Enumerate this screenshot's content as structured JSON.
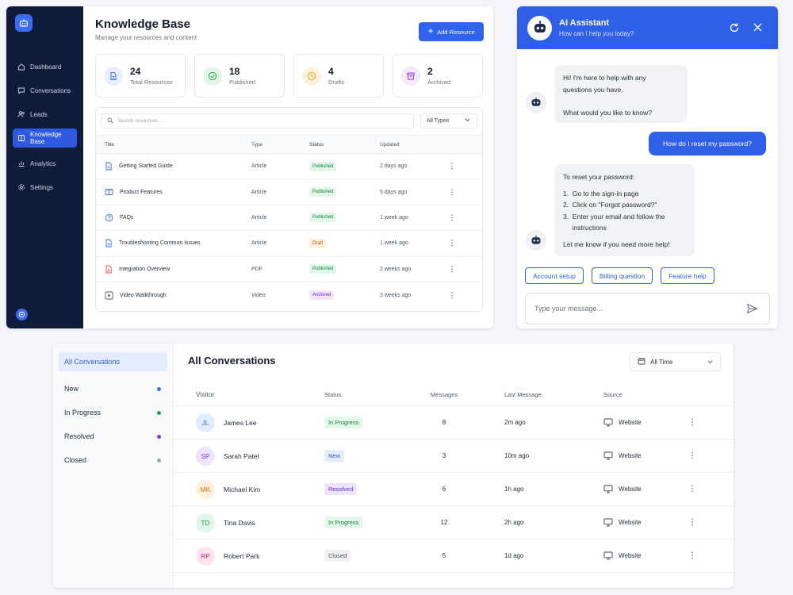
{
  "knowledge_base": {
    "sidebar": {
      "items": [
        {
          "label": "Dashboard",
          "icon": "home-icon"
        },
        {
          "label": "Conversations",
          "icon": "chat-icon"
        },
        {
          "label": "Leads",
          "icon": "users-icon"
        },
        {
          "label": "Knowledge Base",
          "icon": "book-icon",
          "active": true
        },
        {
          "label": "Analytics",
          "icon": "chart-icon"
        },
        {
          "label": "Settings",
          "icon": "gear-icon"
        }
      ]
    },
    "title": "Knowledge Base",
    "subtitle": "Manage your resources and content",
    "add_button": "Add Resource",
    "stats": [
      {
        "value": "24",
        "label": "Total Resources",
        "color": "#3b6cf6",
        "bg": "#e8effe"
      },
      {
        "value": "18",
        "label": "Published",
        "color": "#16a34a",
        "bg": "#e3f6ea"
      },
      {
        "value": "4",
        "label": "Drafts",
        "color": "#f59e0b",
        "bg": "#fdf1dc"
      },
      {
        "value": "2",
        "label": "Archived",
        "color": "#9333ea",
        "bg": "#f3e8fd"
      }
    ],
    "search_placeholder": "Search resources...",
    "type_filter": "All Types",
    "columns": {
      "title": "Title",
      "type": "Type",
      "status": "Status",
      "updated": "Updated"
    },
    "rows": [
      {
        "title": "Getting Started Guide",
        "type": "Article",
        "status": "Published",
        "updated": "2 days ago",
        "icon": "document-icon"
      },
      {
        "title": "Product Features",
        "type": "Article",
        "status": "Published",
        "updated": "5 days ago",
        "icon": "book-open-icon"
      },
      {
        "title": "FAQs",
        "type": "Article",
        "status": "Published",
        "updated": "1 week ago",
        "icon": "question-icon"
      },
      {
        "title": "Troubleshooting Common Issues",
        "type": "Article",
        "status": "Draft",
        "updated": "1 week ago",
        "icon": "document-icon"
      },
      {
        "title": "Integration Overview",
        "type": "PDF",
        "status": "Published",
        "updated": "2 weeks ago",
        "icon": "pdf-icon"
      },
      {
        "title": "Video Walkthrough",
        "type": "Video",
        "status": "Archived",
        "updated": "3 weeks ago",
        "icon": "play-icon"
      }
    ]
  },
  "assistant": {
    "title": "AI Assistant",
    "subtitle": "How can I help you today?",
    "bot_msg_1": [
      "Hi! I'm here to help with any",
      "questions you have.",
      "",
      "What would you like to know?"
    ],
    "user_msg": "How do I reset my password?",
    "bot_msg_2": {
      "intro": "To reset your password:",
      "steps": [
        "1.  Go to the sign-in page",
        "2.  Click on \"Forgot password?\"",
        "3.  Enter your email and follow the",
        "     instructions"
      ],
      "outro": "Let me know if you need more help!"
    },
    "quick_replies": [
      "Account setup",
      "Billing question",
      "Feature help"
    ],
    "input_placeholder": "Type your message..."
  },
  "conversations": {
    "filters": [
      {
        "label": "All Conversations",
        "active": true
      },
      {
        "label": "New",
        "dot": "#3b6cf6"
      },
      {
        "label": "In Progress",
        "dot": "#16a34a"
      },
      {
        "label": "Resolved",
        "dot": "#7c3aed"
      },
      {
        "label": "Closed",
        "dot": "#9ca3af"
      }
    ],
    "title": "All Conversations",
    "time_filter": "All Time",
    "columns": {
      "visitor": "Visitor",
      "status": "Status",
      "messages": "Messages",
      "last": "Last Message",
      "source": "Source"
    },
    "rows": [
      {
        "initials": "JL",
        "name": "James Lee",
        "status": "In Progress",
        "messages": "8",
        "last": "2m ago",
        "source": "Website",
        "av_bg": "#e0ecfd",
        "av_fg": "#3b6cf6"
      },
      {
        "initials": "SP",
        "name": "Sarah Patel",
        "status": "New",
        "messages": "3",
        "last": "10m ago",
        "source": "Website",
        "av_bg": "#ede4fd",
        "av_fg": "#7c3aed"
      },
      {
        "initials": "MK",
        "name": "Michael Kim",
        "status": "Resolved",
        "messages": "6",
        "last": "1h ago",
        "source": "Website",
        "av_bg": "#fdf0dc",
        "av_fg": "#d97706"
      },
      {
        "initials": "TD",
        "name": "Tina Davis",
        "status": "In Progress",
        "messages": "12",
        "last": "2h ago",
        "source": "Website",
        "av_bg": "#e1f5e8",
        "av_fg": "#16a34a"
      },
      {
        "initials": "RP",
        "name": "Robert Park",
        "status": "Closed",
        "messages": "5",
        "last": "1d ago",
        "source": "Website",
        "av_bg": "#fde4ef",
        "av_fg": "#db2777"
      }
    ]
  },
  "status_colors": {
    "Published": {
      "bg": "#e3f6ea",
      "fg": "#15803d"
    },
    "Draft": {
      "bg": "#fdf1dc",
      "fg": "#b45309"
    },
    "Archived": {
      "bg": "#f1e6fd",
      "fg": "#7e22ce"
    },
    "In Progress": {
      "bg": "#e3f6ea",
      "fg": "#15803d"
    },
    "New": {
      "bg": "#e3edfd",
      "fg": "#2563eb"
    },
    "Resolved": {
      "bg": "#ede4fd",
      "fg": "#6d28d9"
    },
    "Closed": {
      "bg": "#eef0f3",
      "fg": "#4b5563"
    }
  }
}
